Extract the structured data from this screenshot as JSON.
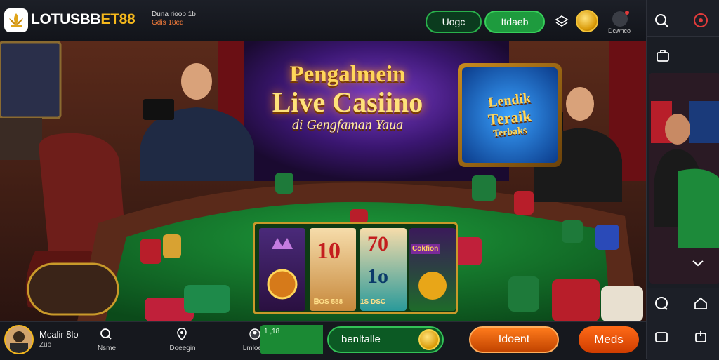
{
  "header": {
    "brand_part1": "LOTUSBB",
    "brand_part2": "ET88",
    "mini_line1": "Duna rioob 1b",
    "mini_line2": "Gdis 18ed",
    "login_label": "Uogc",
    "register_label": "Itdaeb",
    "download_label": "Dcwnco"
  },
  "hero": {
    "line1": "Pengalmein",
    "line2": "Live Casiino",
    "line3": "di Gengfaman Yaua",
    "tablet_line1": "Lendik",
    "tablet_line2": "Teraik",
    "tablet_line3": "Terbaks"
  },
  "slot": {
    "reel2_top": "10",
    "reel3_top": "70",
    "reel3_mid": "1o",
    "reel4_top": "Cokfion",
    "caption_left": "ᗷOS 588",
    "caption_right": "1S DSC"
  },
  "bottom_nav": {
    "user_name": "Mcalir 8lo",
    "user_sub": "Zuo",
    "item1": "Nsme",
    "item2": "Doeegin",
    "item3": "Lmloenio",
    "wallet_value": "1 ,18",
    "balance_label": "benltalle",
    "deposit_label": "Idoent",
    "menu_label": "Meds"
  },
  "colors": {
    "accent_gold": "#f5b81c",
    "green": "#29b14b",
    "orange": "#ff7b1c"
  }
}
